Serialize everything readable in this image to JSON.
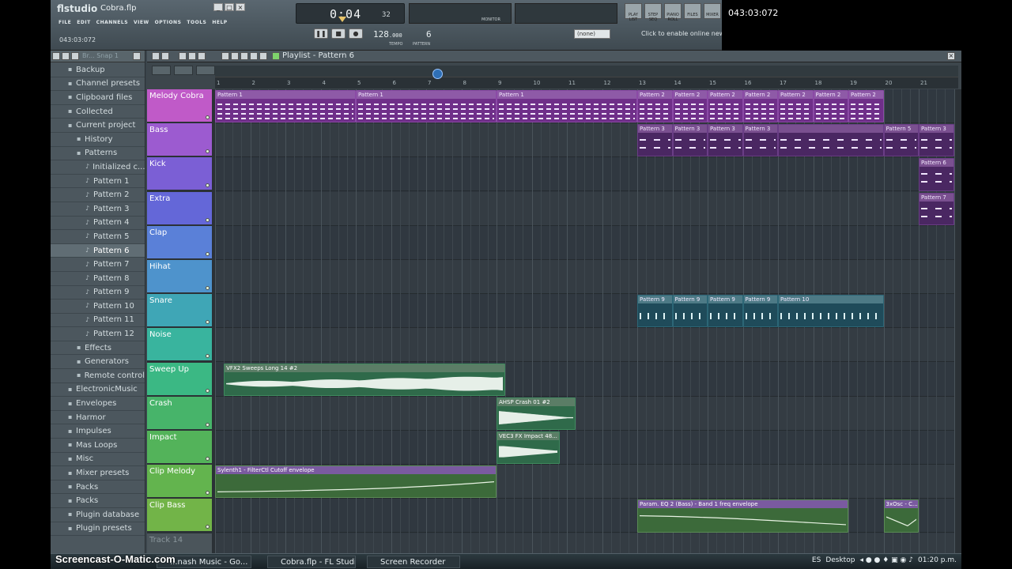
{
  "app": {
    "logo": "flstudio",
    "filename": "Cobra.flp",
    "menu": [
      "FILE",
      "EDIT",
      "CHANNELS",
      "VIEW",
      "OPTIONS",
      "TOOLS",
      "HELP"
    ],
    "hint_text": "043:03:072"
  },
  "transport": {
    "time": "0:04",
    "time_fraction": "32",
    "tempo": "128",
    "tempo_decimal": ".000",
    "tempo_label": "TEMPO",
    "pattern_number": "6",
    "pattern_label": "PATTERN",
    "monitor_label": "MONITOR",
    "snap": "(none)",
    "news": "Click to enable online news",
    "hint_panel_time": "043:03:072",
    "shortcut_buttons": [
      "PLAY LIST",
      "STEP SEQ",
      "PIANO ROLL",
      "FILES",
      "MIXER"
    ]
  },
  "browser": {
    "title": "Br... Snap 1",
    "items": [
      {
        "label": "Backup",
        "level": 0,
        "icon": "folder-icon"
      },
      {
        "label": "Channel presets",
        "level": 0,
        "icon": "folder-icon"
      },
      {
        "label": "Clipboard files",
        "level": 0,
        "icon": "folder-icon"
      },
      {
        "label": "Collected",
        "level": 0,
        "icon": "folder-icon"
      },
      {
        "label": "Current project",
        "level": 0,
        "icon": "folder-icon"
      },
      {
        "label": "History",
        "level": 1,
        "icon": "folder-icon"
      },
      {
        "label": "Patterns",
        "level": 1,
        "icon": "folder-icon"
      },
      {
        "label": "Initialized c...",
        "level": 2,
        "icon": "note-icon"
      },
      {
        "label": "Pattern 1",
        "level": 2,
        "icon": "note-icon"
      },
      {
        "label": "Pattern 2",
        "level": 2,
        "icon": "note-icon"
      },
      {
        "label": "Pattern 3",
        "level": 2,
        "icon": "note-icon"
      },
      {
        "label": "Pattern 4",
        "level": 2,
        "icon": "note-icon"
      },
      {
        "label": "Pattern 5",
        "level": 2,
        "icon": "note-icon"
      },
      {
        "label": "Pattern 6",
        "level": 2,
        "icon": "note-icon",
        "selected": true
      },
      {
        "label": "Pattern 7",
        "level": 2,
        "icon": "note-icon"
      },
      {
        "label": "Pattern 8",
        "level": 2,
        "icon": "note-icon"
      },
      {
        "label": "Pattern 9",
        "level": 2,
        "icon": "note-icon"
      },
      {
        "label": "Pattern 10",
        "level": 2,
        "icon": "note-icon"
      },
      {
        "label": "Pattern 11",
        "level": 2,
        "icon": "note-icon"
      },
      {
        "label": "Pattern 12",
        "level": 2,
        "icon": "note-icon"
      },
      {
        "label": "Effects",
        "level": 1,
        "icon": "folder-icon"
      },
      {
        "label": "Generators",
        "level": 1,
        "icon": "folder-icon"
      },
      {
        "label": "Remote control",
        "level": 1,
        "icon": "folder-icon"
      },
      {
        "label": "ElectronicMusic",
        "level": 0,
        "icon": "folder-icon"
      },
      {
        "label": "Envelopes",
        "level": 0,
        "icon": "folder-icon"
      },
      {
        "label": "Harmor",
        "level": 0,
        "icon": "folder-icon"
      },
      {
        "label": "Impulses",
        "level": 0,
        "icon": "folder-icon"
      },
      {
        "label": "Mas Loops",
        "level": 0,
        "icon": "folder-icon"
      },
      {
        "label": "Misc",
        "level": 0,
        "icon": "folder-icon"
      },
      {
        "label": "Mixer presets",
        "level": 0,
        "icon": "folder-icon"
      },
      {
        "label": "Packs",
        "level": 0,
        "icon": "folder-icon"
      },
      {
        "label": "Packs",
        "level": 0,
        "icon": "folder-icon"
      },
      {
        "label": "Plugin database",
        "level": 0,
        "icon": "folder-icon"
      },
      {
        "label": "Plugin presets",
        "level": 0,
        "icon": "folder-icon"
      }
    ]
  },
  "playlist": {
    "title": "Playlist - Pattern 6",
    "bars": [
      "1",
      "2",
      "3",
      "4",
      "5",
      "6",
      "7",
      "8",
      "9",
      "10",
      "11",
      "12",
      "13",
      "14",
      "15",
      "16",
      "17",
      "18",
      "19",
      "20",
      "21"
    ],
    "tracks": [
      {
        "name": "Melody Cobra",
        "color": "#c05ac8"
      },
      {
        "name": "Bass",
        "color": "#9c5bd0"
      },
      {
        "name": "Kick",
        "color": "#7b5fd5"
      },
      {
        "name": "Extra",
        "color": "#6467d8"
      },
      {
        "name": "Clap",
        "color": "#5a80d8"
      },
      {
        "name": "Hihat",
        "color": "#4e93cc"
      },
      {
        "name": "Snare",
        "color": "#3fa6b6"
      },
      {
        "name": "Noise",
        "color": "#39b49e"
      },
      {
        "name": "Sweep Up",
        "color": "#3bb884"
      },
      {
        "name": "Crash",
        "color": "#47b46a"
      },
      {
        "name": "Impact",
        "color": "#53b35a"
      },
      {
        "name": "Clip Melody",
        "color": "#63b44e"
      },
      {
        "name": "Clip Bass",
        "color": "#72b448"
      },
      {
        "name": "Track 14",
        "color": "#4b555b"
      }
    ],
    "clips": [
      {
        "track": 0,
        "start": 1,
        "len": 4,
        "label": "Pattern 1",
        "kind": "pat-melody"
      },
      {
        "track": 0,
        "start": 5,
        "len": 4,
        "label": "Pattern 1",
        "kind": "pat-melody"
      },
      {
        "track": 0,
        "start": 9,
        "len": 4,
        "label": "Pattern 1",
        "kind": "pat-melody"
      },
      {
        "track": 0,
        "start": 13,
        "len": 1,
        "label": "Pattern 2",
        "kind": "pat-melody"
      },
      {
        "track": 0,
        "start": 14,
        "len": 1,
        "label": "Pattern 2",
        "kind": "pat-melody"
      },
      {
        "track": 0,
        "start": 15,
        "len": 1,
        "label": "Pattern 2",
        "kind": "pat-melody"
      },
      {
        "track": 0,
        "start": 16,
        "len": 1,
        "label": "Pattern 2",
        "kind": "pat-melody"
      },
      {
        "track": 0,
        "start": 17,
        "len": 1,
        "label": "Pattern 2",
        "kind": "pat-melody"
      },
      {
        "track": 0,
        "start": 18,
        "len": 1,
        "label": "Pattern 2",
        "kind": "pat-melody"
      },
      {
        "track": 0,
        "start": 19,
        "len": 1,
        "label": "Pattern 2",
        "kind": "pat-melody"
      },
      {
        "track": 1,
        "start": 13,
        "len": 1,
        "label": "Pattern 3",
        "kind": "pat-bass"
      },
      {
        "track": 1,
        "start": 14,
        "len": 1,
        "label": "Pattern 3",
        "kind": "pat-bass"
      },
      {
        "track": 1,
        "start": 15,
        "len": 1,
        "label": "Pattern 3",
        "kind": "pat-bass"
      },
      {
        "track": 1,
        "start": 16,
        "len": 1,
        "label": "Pattern 3",
        "kind": "pat-bass"
      },
      {
        "track": 1,
        "start": 17,
        "len": 3,
        "label": "",
        "kind": "pat-bass"
      },
      {
        "track": 1,
        "start": 20,
        "len": 1,
        "label": "Pattern 5",
        "kind": "pat-bass"
      },
      {
        "track": 1,
        "start": 21,
        "len": 1,
        "label": "Pattern 3",
        "kind": "pat-bass"
      },
      {
        "track": 2,
        "start": 21,
        "len": 1,
        "label": "Pattern 6",
        "kind": "pat-bass"
      },
      {
        "track": 3,
        "start": 21,
        "len": 1,
        "label": "Pattern 7",
        "kind": "pat-bass"
      },
      {
        "track": 6,
        "start": 13,
        "len": 1,
        "label": "Pattern 9",
        "kind": "pat-snare"
      },
      {
        "track": 6,
        "start": 14,
        "len": 1,
        "label": "Pattern 9",
        "kind": "pat-snare"
      },
      {
        "track": 6,
        "start": 15,
        "len": 1,
        "label": "Pattern 9",
        "kind": "pat-snare"
      },
      {
        "track": 6,
        "start": 16,
        "len": 1,
        "label": "Pattern 9",
        "kind": "pat-snare"
      },
      {
        "track": 6,
        "start": 17,
        "len": 3,
        "label": "Pattern 10",
        "kind": "pat-snare"
      },
      {
        "track": 8,
        "start": 1.25,
        "len": 8,
        "label": "VFX2 Sweeps Long 14 #2",
        "kind": "audio"
      },
      {
        "track": 9,
        "start": 9,
        "len": 2.25,
        "label": "AHSP Crash 01 #2",
        "kind": "audio"
      },
      {
        "track": 10,
        "start": 9,
        "len": 1.8,
        "label": "VEC3 FX Impact 48...",
        "kind": "audio"
      },
      {
        "track": 11,
        "start": 1,
        "len": 8,
        "label": "Sylenth1 - FilterCtl Cutoff envelope",
        "kind": "auto"
      },
      {
        "track": 12,
        "start": 13,
        "len": 6,
        "label": "Param. EQ 2 (Bass) - Band 1 freq envelope",
        "kind": "auto"
      },
      {
        "track": 12,
        "start": 20,
        "len": 1,
        "label": "3xOsc - C...",
        "kind": "auto"
      }
    ]
  },
  "taskbar": {
    "tasks": [
      "...nash Music - Go...",
      "Cobra.flp - FL Studi...",
      "Screen Recorder"
    ],
    "language": "ES",
    "desktop": "Desktop",
    "clock": "01:20 p.m."
  },
  "watermark": "Screencast-O-Matic.com"
}
